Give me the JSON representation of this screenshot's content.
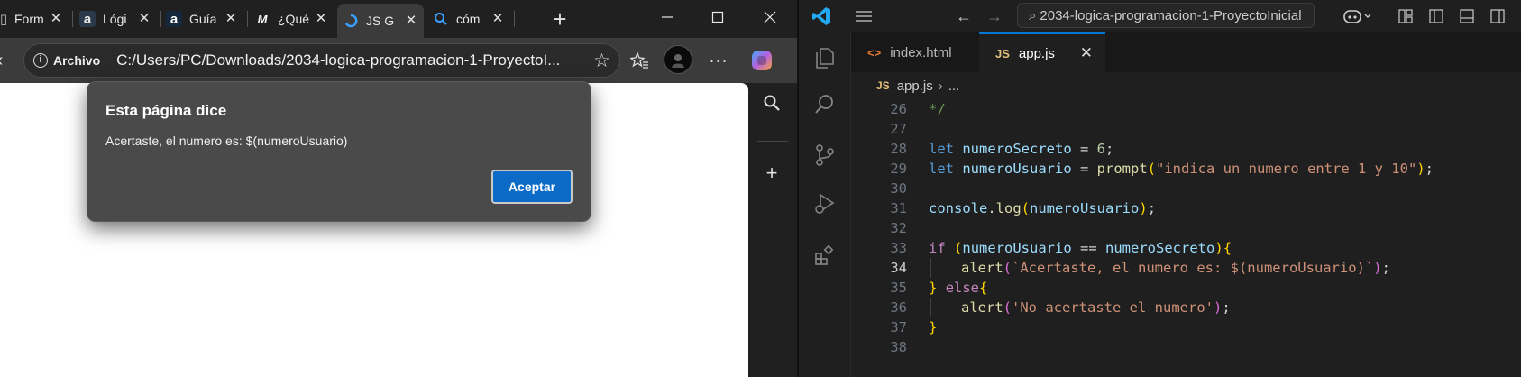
{
  "browser": {
    "tabs": [
      {
        "label": "Form",
        "favicon": "generic-tab-icon"
      },
      {
        "label": "Lógi",
        "favicon": "alura-a-icon"
      },
      {
        "label": "Guía",
        "favicon": "alura-a-icon"
      },
      {
        "label": "¿Qué",
        "favicon": "m-logo-icon"
      },
      {
        "label": "JS G",
        "favicon": "loading-spinner-icon",
        "active": true
      },
      {
        "label": "cóm",
        "favicon": "search-icon"
      }
    ],
    "new_tab_symbol": "+",
    "address": {
      "info_label": "Archivo",
      "url": "C:/Users/PC/Downloads/2034-logica-programacion-1-ProyectoI..."
    },
    "dialog": {
      "title": "Esta página dice",
      "message": "Acertaste, el numero es: $(numeroUsuario)",
      "ok_label": "Aceptar"
    }
  },
  "vscode": {
    "command_center": "2034-logica-programacion-1-ProyectoInicial",
    "tabs": [
      {
        "label": "index.html",
        "icon": "html-file-icon",
        "badge": "<>"
      },
      {
        "label": "app.js",
        "icon": "js-file-icon",
        "badge": "JS",
        "active": true
      }
    ],
    "breadcrumb": {
      "badge": "JS",
      "file": "app.js",
      "rest": "..."
    },
    "accent_color": "#0078d4",
    "current_line": 34,
    "code_lines": [
      {
        "n": "26",
        "text": "*/"
      },
      {
        "n": "27",
        "text": ""
      },
      {
        "n": "28",
        "text": "let numeroSecreto = 6;"
      },
      {
        "n": "29",
        "text": "let numeroUsuario = prompt(\"indica un numero entre 1 y 10\");"
      },
      {
        "n": "30",
        "text": ""
      },
      {
        "n": "31",
        "text": "console.log(numeroUsuario);"
      },
      {
        "n": "32",
        "text": ""
      },
      {
        "n": "33",
        "text": "if (numeroUsuario == numeroSecreto){"
      },
      {
        "n": "34",
        "text": "alert(`Acertaste, el numero es: $(numeroUsuario)`);"
      },
      {
        "n": "35",
        "text": "} else{"
      },
      {
        "n": "36",
        "text": "alert('No acertaste el numero');"
      },
      {
        "n": "37",
        "text": "}"
      },
      {
        "n": "38",
        "text": ""
      }
    ]
  }
}
